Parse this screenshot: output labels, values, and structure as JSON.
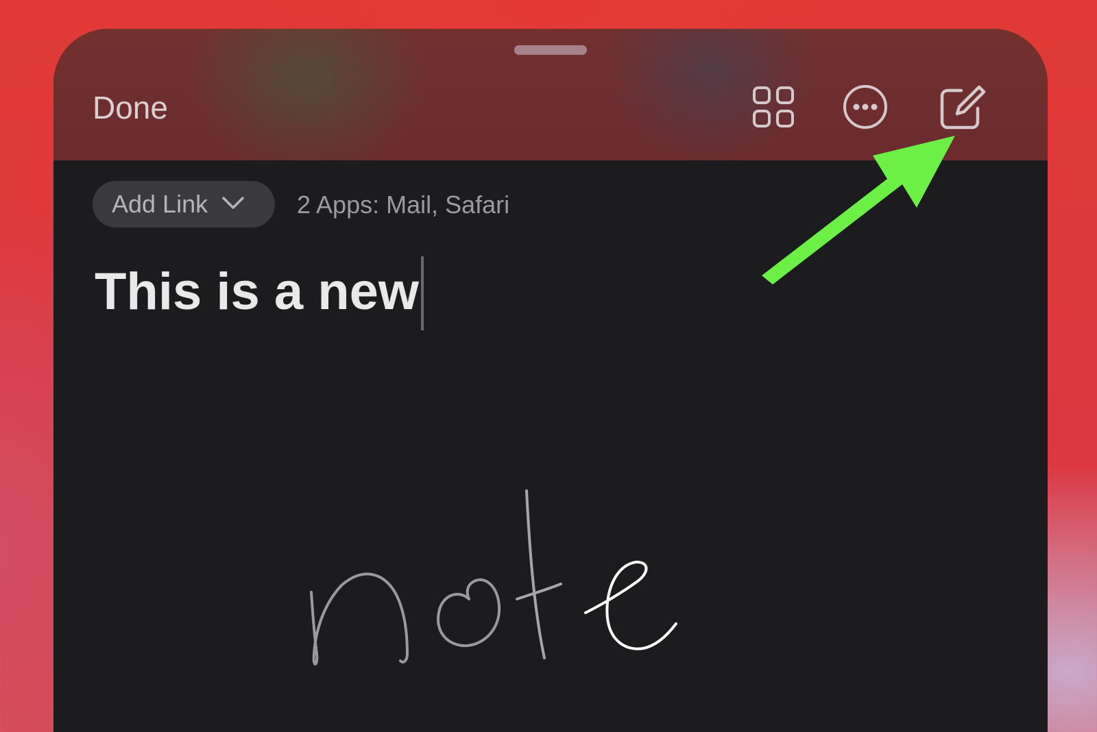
{
  "header": {
    "done_label": "Done",
    "icons": [
      "grid-icon",
      "more-icon",
      "compose-icon"
    ]
  },
  "link_bar": {
    "add_link_label": "Add Link",
    "apps_text": "2 Apps: Mail, Safari"
  },
  "note": {
    "title_text": "This is a new",
    "handwritten_text": "note"
  },
  "colors": {
    "header_bg": "#6b2b2e",
    "body_bg": "#1c1c1e",
    "arrow": "#6cf046",
    "accent_text": "#dccfd0"
  }
}
